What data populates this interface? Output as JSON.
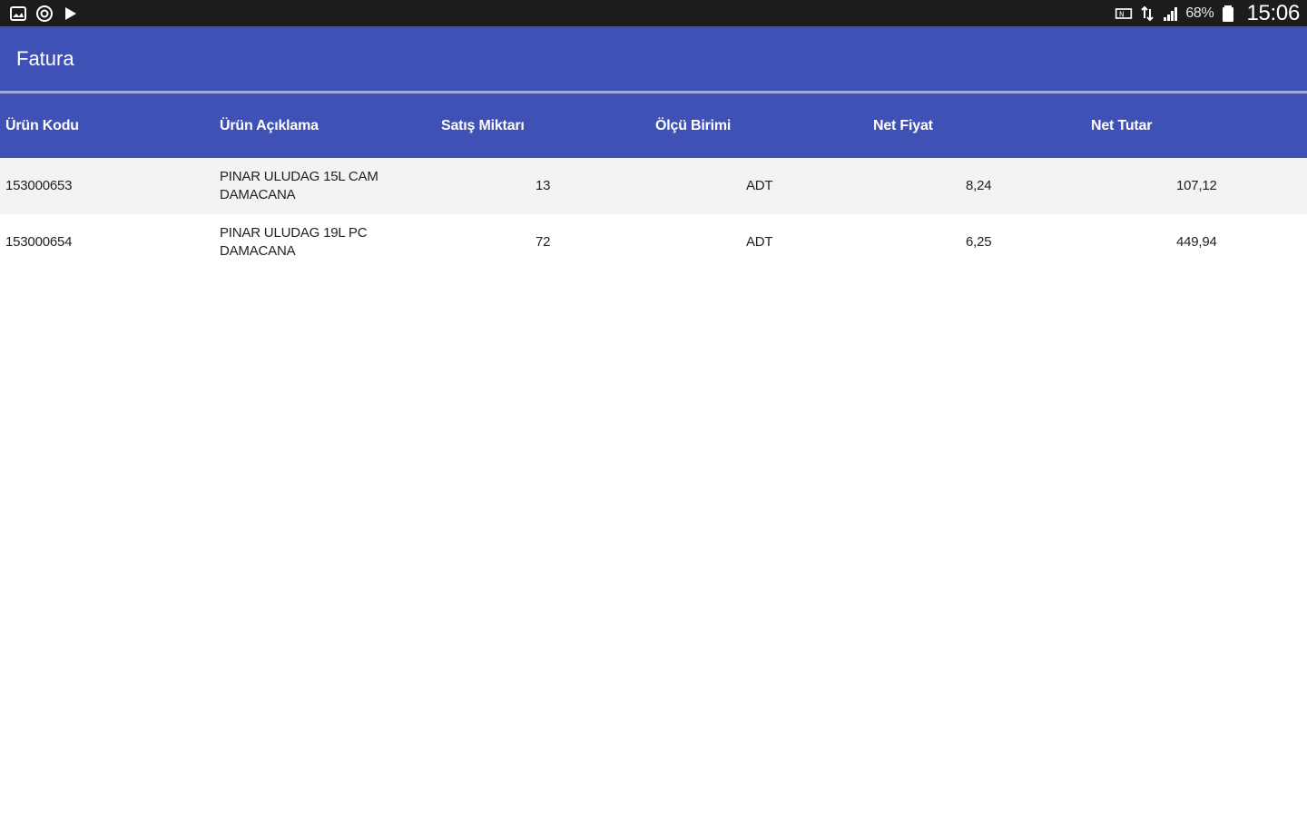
{
  "status_bar": {
    "left_icons": [
      "gallery-icon",
      "target-icon",
      "play-store-icon"
    ],
    "right_icons": [
      "nfc-icon",
      "data-transfer-icon",
      "signal-icon",
      "battery-icon"
    ],
    "battery_percent": "68%",
    "time": "15:06"
  },
  "app_bar": {
    "title": "Fatura",
    "color": "#3f51b5"
  },
  "table": {
    "headers": [
      "Ürün Kodu",
      "Ürün Açıklama",
      "Satış Miktarı",
      "Ölçü Birimi",
      "Net Fiyat",
      "Net Tutar"
    ],
    "rows": [
      {
        "code": "153000653",
        "description": "PINAR ULUDAG 15L CAM DAMACANA",
        "quantity": "13",
        "unit": "ADT",
        "net_price": "8,24",
        "net_total": "107,12"
      },
      {
        "code": "153000654",
        "description": "PINAR ULUDAG 19L PC DAMACANA",
        "quantity": "72",
        "unit": "ADT",
        "net_price": "6,25",
        "net_total": "449,94"
      }
    ]
  }
}
